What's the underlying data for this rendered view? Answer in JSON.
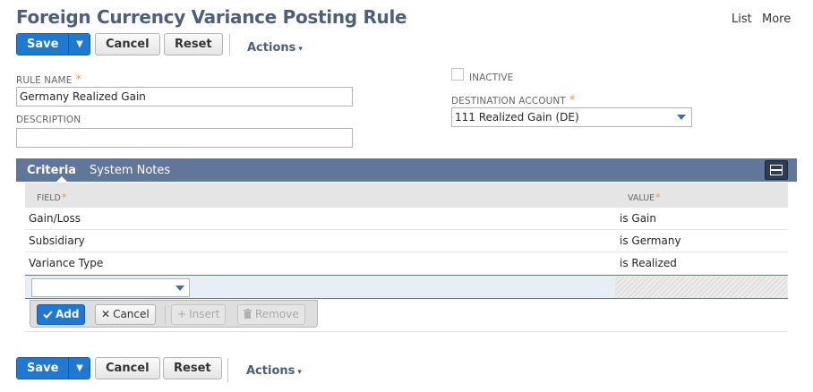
{
  "page": {
    "title": "Foreign Currency Variance Posting Rule",
    "links": {
      "list": "List",
      "more": "More"
    }
  },
  "toolbar": {
    "save": "Save",
    "save_dropdown": "▼",
    "cancel": "Cancel",
    "reset": "Reset",
    "actions": "Actions",
    "actions_caret": "▾"
  },
  "form": {
    "rule_name": {
      "label": "RULE NAME",
      "required": "*",
      "value": "Germany Realized Gain"
    },
    "description": {
      "label": "DESCRIPTION",
      "value": ""
    },
    "inactive": {
      "label": "INACTIVE",
      "checked": false
    },
    "destination_account": {
      "label": "DESTINATION ACCOUNT",
      "required": "*",
      "value": "111 Realized Gain (DE)"
    }
  },
  "tabs": [
    {
      "label": "Criteria",
      "active": true
    },
    {
      "label": "System Notes",
      "active": false
    }
  ],
  "grid": {
    "columns": [
      {
        "label": "FIELD",
        "required": "*"
      },
      {
        "label": "VALUE",
        "required": "*"
      }
    ],
    "rows": [
      {
        "field": "Gain/Loss",
        "value": "is Gain"
      },
      {
        "field": "Subsidiary",
        "value": "is Germany"
      },
      {
        "field": "Variance Type",
        "value": "is Realized"
      }
    ],
    "edit_row": {
      "field_value": ""
    },
    "buttons": {
      "add": "Add",
      "cancel": "Cancel",
      "insert": "Insert",
      "remove": "Remove"
    }
  },
  "icons": {
    "add": "check-icon",
    "cancel": "x-icon",
    "insert": "plus-icon",
    "remove": "trash-icon",
    "tab_toggle": "layout-toggle-icon"
  },
  "colors": {
    "primary_button": "#1f78d1",
    "title": "#4d5f79",
    "tabbar": "#607799",
    "required": "#e79b39"
  }
}
